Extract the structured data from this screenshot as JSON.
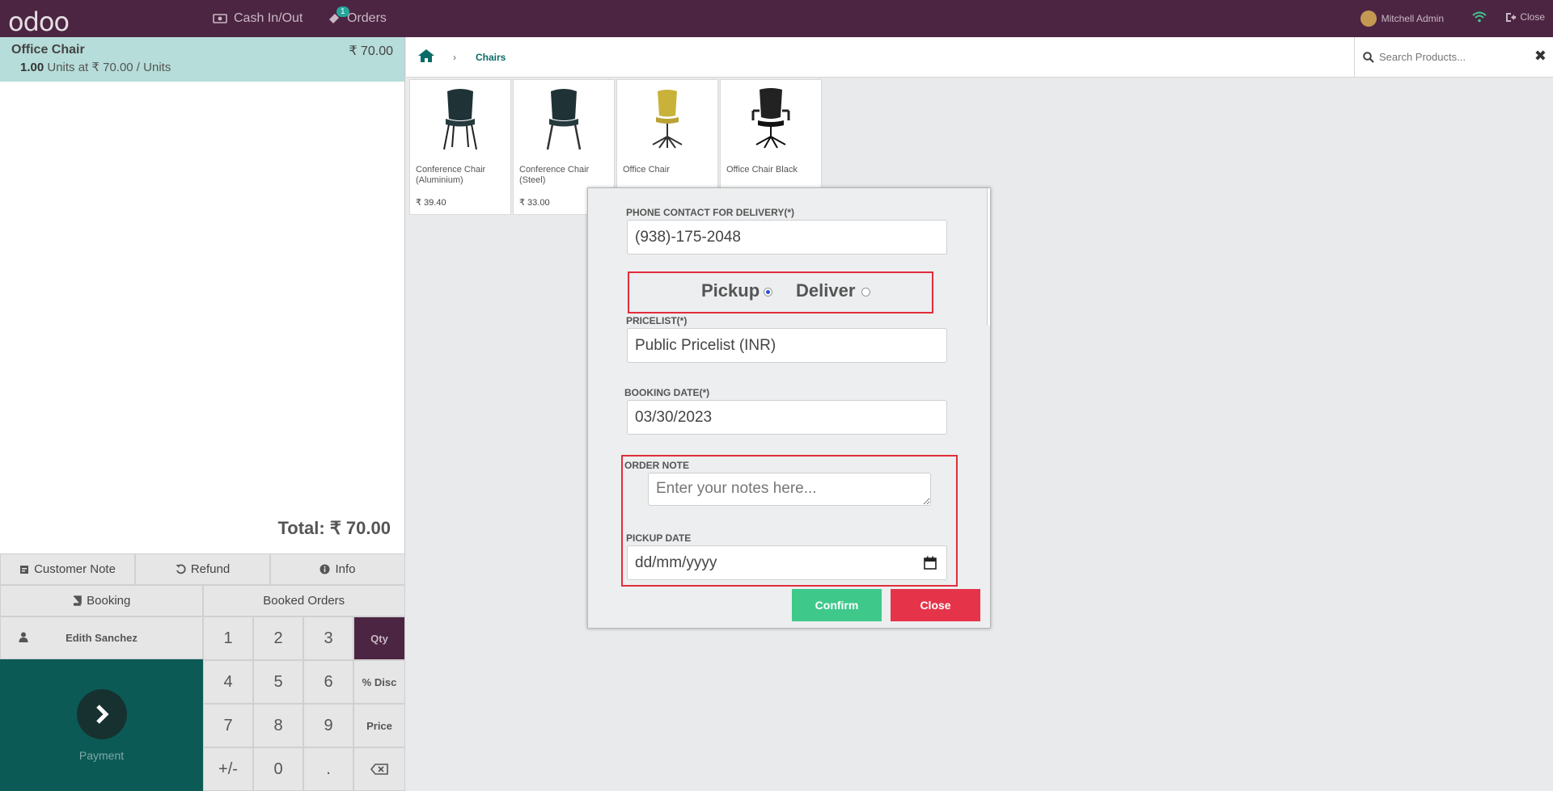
{
  "topbar": {
    "logo": "odoo",
    "cash_label": "Cash In/Out",
    "orders_label": "Orders",
    "orders_badge": "1",
    "user_name": "Mitchell Admin",
    "close_label": "Close"
  },
  "order": {
    "line_name": "Office Chair",
    "line_price": "₹ 70.00",
    "line_qty": "1.00",
    "line_detail": "Units at ₹ 70.00 / Units",
    "total": "Total: ₹ 70.00"
  },
  "controls": {
    "customer_note": "Customer Note",
    "refund": "Refund",
    "info": "Info",
    "booking": "Booking",
    "booked_orders": "Booked Orders",
    "customer": "Edith Sanchez",
    "payment": "Payment"
  },
  "numpad": {
    "k1": "1",
    "k2": "2",
    "k3": "3",
    "qty": "Qty",
    "k4": "4",
    "k5": "5",
    "k6": "6",
    "disc": "% Disc",
    "k7": "7",
    "k8": "8",
    "k9": "9",
    "price": "Price",
    "plusminus": "+/-",
    "k0": "0",
    "dot": "."
  },
  "breadcrumb": {
    "category": "Chairs"
  },
  "search": {
    "placeholder": "Search Products..."
  },
  "products": [
    {
      "name": "Conference Chair (Aluminium)",
      "price": "₹ 39.40"
    },
    {
      "name": "Conference Chair (Steel)",
      "price": "₹ 33.00"
    },
    {
      "name": "Office Chair",
      "price": ""
    },
    {
      "name": "Office Chair Black",
      "price": ""
    }
  ],
  "modal": {
    "phone_label": "PHONE CONTACT FOR DELIVERY(*)",
    "phone_value": "(938)-175-2048",
    "pickup_label": "Pickup",
    "deliver_label": "Deliver",
    "selected_mode": "Pickup",
    "pricelist_label": "PRICELIST(*)",
    "pricelist_value": "Public Pricelist (INR)",
    "booking_date_label": "BOOKING DATE(*)",
    "booking_date_value": "03/30/2023",
    "order_note_label": "ORDER NOTE",
    "order_note_placeholder": "Enter your notes here...",
    "pickup_date_label": "PICKUP DATE",
    "pickup_date_value": "dd/mm/yyyy",
    "confirm_label": "Confirm",
    "close_label": "Close"
  },
  "colors": {
    "topbar": "#4c2542",
    "teal": "#0b5a56",
    "orderline": "#b6ddd9",
    "confirm": "#3ec98b",
    "close": "#e5344a",
    "highlight": "#e12d3a"
  }
}
